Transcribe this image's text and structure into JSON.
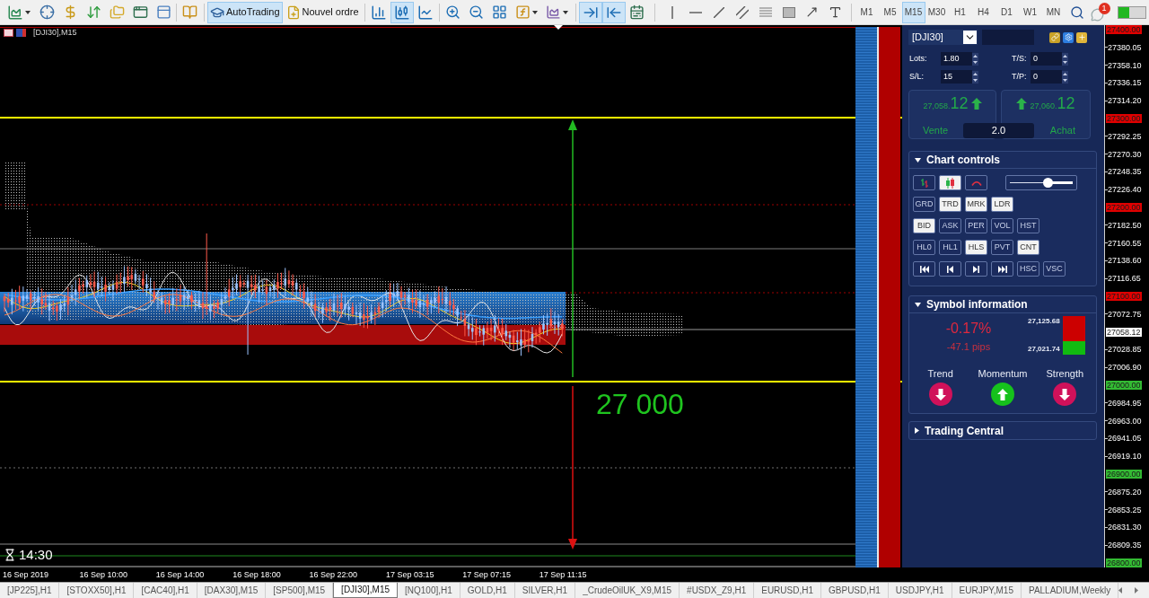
{
  "toolbar": {
    "buttons": [
      {
        "kind": "autotrading",
        "label": "AutoTrading",
        "selected": true
      },
      {
        "kind": "new-order",
        "label": "Nouvel ordre",
        "selected": false
      }
    ],
    "chart_modes": [
      {
        "kind": "bars",
        "selected": false
      },
      {
        "kind": "candles",
        "selected": true
      },
      {
        "kind": "line",
        "selected": false
      }
    ],
    "view_toggles": [
      {
        "kind": "chart-shift",
        "selected": true
      },
      {
        "kind": "auto-scroll",
        "selected": true
      }
    ],
    "timeframes": [
      {
        "label": "M1",
        "selected": false
      },
      {
        "label": "M5",
        "selected": false
      },
      {
        "label": "M15",
        "selected": true
      },
      {
        "label": "M30",
        "selected": false
      },
      {
        "label": "H1",
        "selected": false
      },
      {
        "label": "H4",
        "selected": false
      },
      {
        "label": "D1",
        "selected": false
      },
      {
        "label": "W1",
        "selected": false
      },
      {
        "label": "MN",
        "selected": false
      }
    ],
    "notification_count": "1"
  },
  "chart": {
    "title": "[DJI30],M15",
    "price_label": "27 000",
    "candle_timer": "14:30",
    "price_axis": [
      {
        "kind": "marker",
        "label": "27400.00",
        "color": "#e00000"
      },
      {
        "kind": "tick",
        "label": "27380.05"
      },
      {
        "kind": "tick",
        "label": "27358.10"
      },
      {
        "kind": "tick",
        "label": "27336.15"
      },
      {
        "kind": "tick",
        "label": "27314.20"
      },
      {
        "kind": "marker",
        "label": "27300.00",
        "color": "#e00000"
      },
      {
        "kind": "tick",
        "label": "27292.25"
      },
      {
        "kind": "tick",
        "label": "27270.30"
      },
      {
        "kind": "tick",
        "label": "27248.35"
      },
      {
        "kind": "tick",
        "label": "27226.40"
      },
      {
        "kind": "marker",
        "label": "27200.00",
        "color": "#e00000"
      },
      {
        "kind": "tick",
        "label": "27182.50"
      },
      {
        "kind": "tick",
        "label": "27160.55"
      },
      {
        "kind": "tick",
        "label": "27138.60"
      },
      {
        "kind": "tick",
        "label": "27116.65"
      },
      {
        "kind": "marker",
        "label": "27100.00",
        "color": "#e00000"
      },
      {
        "kind": "tick",
        "label": "27072.75"
      },
      {
        "kind": "marker",
        "label": "27058.12",
        "color": "#ffffff"
      },
      {
        "kind": "tick",
        "label": "27028.85"
      },
      {
        "kind": "tick",
        "label": "27006.90"
      },
      {
        "kind": "marker",
        "label": "27000.00",
        "color": "#33bb33"
      },
      {
        "kind": "tick",
        "label": "26984.95"
      },
      {
        "kind": "tick",
        "label": "26963.00"
      },
      {
        "kind": "tick",
        "label": "26941.05"
      },
      {
        "kind": "tick",
        "label": "26919.10"
      },
      {
        "kind": "marker",
        "label": "26900.00",
        "color": "#33bb33"
      },
      {
        "kind": "tick",
        "label": "26875.20"
      },
      {
        "kind": "tick",
        "label": "26853.25"
      },
      {
        "kind": "tick",
        "label": "26831.30"
      },
      {
        "kind": "tick",
        "label": "26809.35"
      },
      {
        "kind": "marker",
        "label": "26800.00",
        "color": "#33bb33"
      }
    ],
    "time_axis": [
      "16 Sep 2019",
      "16 Sep 10:00",
      "16 Sep 14:00",
      "16 Sep 18:00",
      "16 Sep 22:00",
      "17 Sep 03:15",
      "17 Sep 07:15",
      "17 Sep 11:15"
    ]
  },
  "order_panel": {
    "symbol": "[DJI30]",
    "fields": [
      {
        "label": "Lots:",
        "value": "1.80"
      },
      {
        "label": "T/S:",
        "value": "0"
      },
      {
        "label": "S/L:",
        "value": "15"
      },
      {
        "label": "T/P:",
        "value": "0"
      }
    ],
    "sell": {
      "price_main": "27,058.",
      "price_last": "12",
      "label": "Vente"
    },
    "buy": {
      "price_main": "27,060.",
      "price_last": "12",
      "label": "Achat"
    },
    "spread": "2.0"
  },
  "chart_controls": {
    "title": "Chart controls",
    "expanded": true,
    "style_buttons": [
      {
        "kind": "bars",
        "selected": false
      },
      {
        "kind": "candles",
        "selected": true
      },
      {
        "kind": "line",
        "selected": false
      }
    ],
    "zoom_slider": {
      "level": 0.6
    },
    "toggle_rows": [
      [
        {
          "label": "GRD",
          "selected": false
        },
        {
          "label": "TRD",
          "selected": true
        },
        {
          "label": "MRK",
          "selected": true
        },
        {
          "label": "LDR",
          "selected": true
        }
      ],
      [
        {
          "label": "BID",
          "selected": true
        },
        {
          "label": "ASK",
          "selected": false
        },
        {
          "label": "PER",
          "selected": false
        },
        {
          "label": "VOL",
          "selected": false
        },
        {
          "label": "HST",
          "selected": false
        }
      ],
      [
        {
          "label": "HL0",
          "selected": false
        },
        {
          "label": "HL1",
          "selected": false
        },
        {
          "label": "HLS",
          "selected": true
        },
        {
          "label": "PVT",
          "selected": false
        },
        {
          "label": "CNT",
          "selected": true
        }
      ],
      [
        {
          "label": "HSC",
          "selected": false
        },
        {
          "label": "VSC",
          "selected": false
        }
      ]
    ],
    "scroll_buttons": [
      {
        "kind": "first"
      },
      {
        "kind": "previous"
      },
      {
        "kind": "next"
      },
      {
        "kind": "last"
      }
    ]
  },
  "symbol_information": {
    "title": "Symbol information",
    "expanded": true,
    "change_percent": "-0.17%",
    "change_pips": "-47.1 pips",
    "high": "27,125.68",
    "low": "27,021.74",
    "range_bar": {
      "level": 0.35
    },
    "signals": [
      {
        "label": "Trend",
        "kind": "down"
      },
      {
        "label": "Momentum",
        "kind": "up"
      },
      {
        "label": "Strength",
        "kind": "down"
      }
    ]
  },
  "trading_central": {
    "title": "Trading Central",
    "expanded": false
  },
  "tabs": [
    {
      "label": "[JP225],H1",
      "selected": false
    },
    {
      "label": "[STOXX50],H1",
      "selected": false
    },
    {
      "label": "[CAC40],H1",
      "selected": false
    },
    {
      "label": "[DAX30],M15",
      "selected": false
    },
    {
      "label": "[SP500],M15",
      "selected": false
    },
    {
      "label": "[DJI30],M15",
      "selected": true
    },
    {
      "label": "[NQ100],H1",
      "selected": false
    },
    {
      "label": "GOLD,H1",
      "selected": false
    },
    {
      "label": "SILVER,H1",
      "selected": false
    },
    {
      "label": "_CrudeOilUK_X9,M15",
      "selected": false
    },
    {
      "label": "#USDX_Z9,H1",
      "selected": false
    },
    {
      "label": "EURUSD,H1",
      "selected": false
    },
    {
      "label": "GBPUSD,H1",
      "selected": false
    },
    {
      "label": "USDJPY,H1",
      "selected": false
    },
    {
      "label": "EURJPY,M15",
      "selected": false
    },
    {
      "label": "PALLADIUM,Weekly",
      "selected": false
    }
  ]
}
